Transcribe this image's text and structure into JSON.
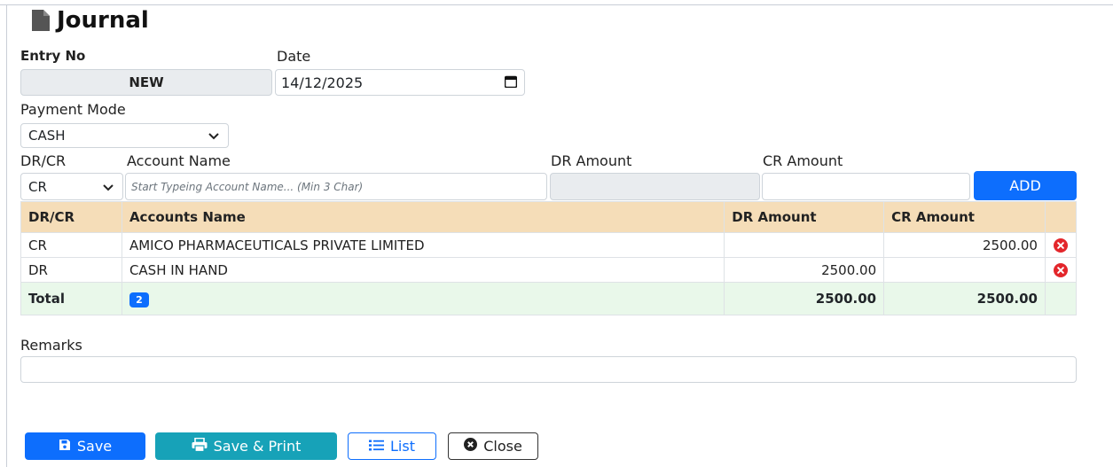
{
  "title": "Journal",
  "form": {
    "entry_no_label": "Entry No",
    "entry_no_value": "NEW",
    "date_label": "Date",
    "date_value": "14/12/2025",
    "payment_mode_label": "Payment Mode",
    "payment_mode_value": "CASH",
    "drcr_label": "DR/CR",
    "account_name_label": "Account Name",
    "dr_amount_label": "DR Amount",
    "cr_amount_label": "CR Amount",
    "drcr_value": "CR",
    "account_placeholder": "Start Typeing Account Name... (Min 3 Char)",
    "add_label": "ADD"
  },
  "table": {
    "headers": [
      "DR/CR",
      "Accounts Name",
      "DR Amount",
      "CR Amount"
    ],
    "rows": [
      {
        "drcr": "CR",
        "account": "AMICO PHARMACEUTICALS PRIVATE LIMITED",
        "dr": "",
        "cr": "2500.00"
      },
      {
        "drcr": "DR",
        "account": "CASH IN HAND",
        "dr": "2500.00",
        "cr": ""
      }
    ],
    "total_label": "Total",
    "count": "2",
    "total_dr": "2500.00",
    "total_cr": "2500.00"
  },
  "remarks_label": "Remarks",
  "buttons": {
    "save": "Save",
    "save_print": "Save & Print",
    "list": "List",
    "close": "Close"
  },
  "colors": {
    "primary": "#0d6efd",
    "info": "#17a2b8",
    "table_header": "#f5ddb8",
    "total_row": "#e9f8ea",
    "delete": "#e3262b"
  }
}
